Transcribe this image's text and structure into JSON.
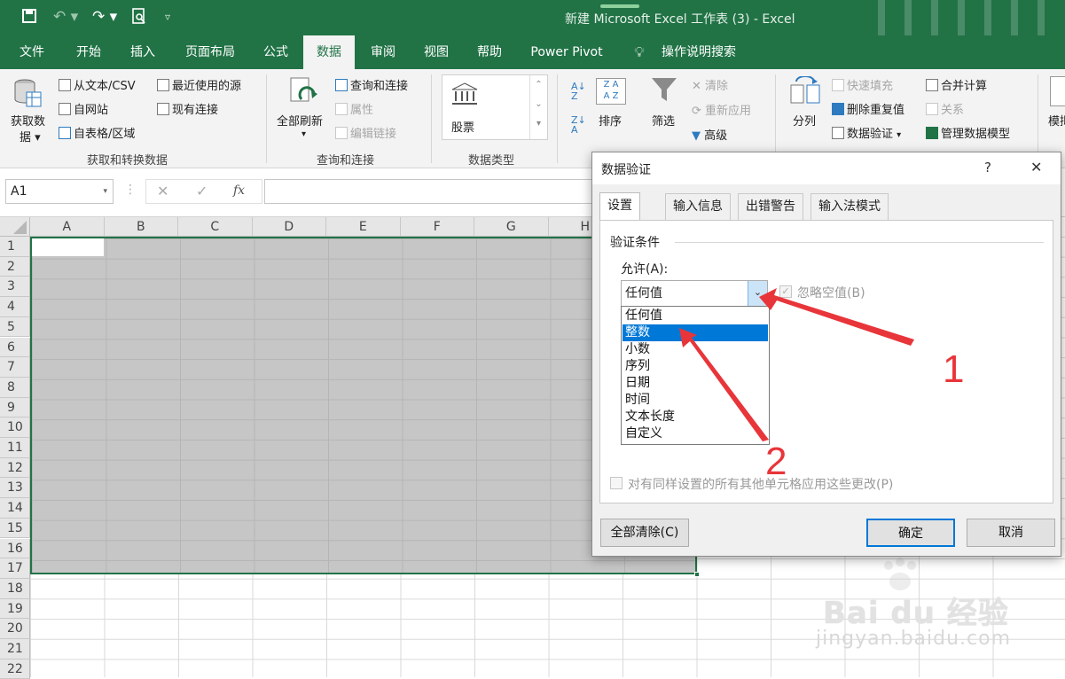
{
  "window": {
    "title": "新建 Microsoft Excel 工作表 (3)  -  Excel"
  },
  "quick_access": {
    "save_icon": "save-icon",
    "undo_icon": "undo-icon",
    "redo_icon": "redo-icon",
    "preview_icon": "print-preview-icon",
    "customize_icon": "customize-icon"
  },
  "tabs": [
    "文件",
    "开始",
    "插入",
    "页面布局",
    "公式",
    "数据",
    "审阅",
    "视图",
    "帮助",
    "Power Pivot"
  ],
  "active_tab": "数据",
  "tell_me": "操作说明搜索",
  "ribbon": {
    "get_data_label": "获取数",
    "get_data_label2": "据 ▾",
    "from_text": "从文本/CSV",
    "from_web": "自网站",
    "from_table": "自表格/区域",
    "recent_sources": "最近使用的源",
    "existing_conn": "现有连接",
    "group1": "获取和转换数据",
    "refresh_all": "全部刷新",
    "refresh_arrow": "▾",
    "queries_conn": "查询和连接",
    "properties": "属性",
    "edit_links": "编辑链接",
    "group2": "查询和连接",
    "stocks": "股票",
    "group3": "数据类型",
    "sort": "排序",
    "filter": "筛选",
    "clear": "清除",
    "reapply": "重新应用",
    "advanced": "高级",
    "text_to_cols": "分列",
    "flash_fill": "快速填充",
    "remove_dup": "删除重复值",
    "data_validation": "数据验证",
    "dv_arrow": "▾",
    "consolidate": "合并计算",
    "relationships": "关系",
    "manage_model": "管理数据模型",
    "whatif": "模拟"
  },
  "formula_bar": {
    "name_box": "A1",
    "fx": "fx"
  },
  "columns": [
    "A",
    "B",
    "C",
    "D",
    "E",
    "F",
    "G",
    "H"
  ],
  "rows": [
    "1",
    "2",
    "3",
    "4",
    "5",
    "6",
    "7",
    "8",
    "9",
    "10",
    "11",
    "12",
    "13",
    "14",
    "15",
    "16",
    "17",
    "18",
    "19",
    "20",
    "21",
    "22"
  ],
  "dialog": {
    "title": "数据验证",
    "help": "?",
    "close": "✕",
    "tabs": [
      "设置",
      "输入信息",
      "出错警告",
      "输入法模式"
    ],
    "section": "验证条件",
    "allow_label": "允许(A):",
    "allow_value": "任何值",
    "ignore_blank": "忽略空值(B)",
    "options": [
      "任何值",
      "整数",
      "小数",
      "序列",
      "日期",
      "时间",
      "文本长度",
      "自定义"
    ],
    "selected_option": "整数",
    "apply_all": "对有同样设置的所有其他单元格应用这些更改(P)",
    "clear_all": "全部清除(C)",
    "ok": "确定",
    "cancel": "取消"
  },
  "annotations": {
    "one": "1",
    "two": "2",
    "color": "#e8353a"
  },
  "watermark": {
    "brand": "Bai du 经验",
    "url": "jingyan.baidu.com"
  },
  "colors": {
    "excel_green": "#217346",
    "selection_gray": "#c6c6c6",
    "highlight_blue": "#0078d7"
  }
}
